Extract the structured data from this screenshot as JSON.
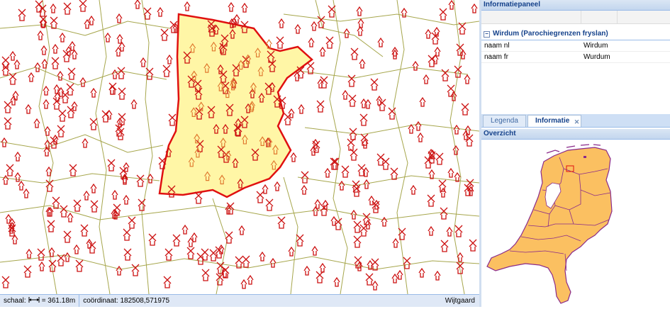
{
  "map": {
    "background": "#ffffff",
    "region_fill": "#fff6a6",
    "region_border": "#e01010",
    "boundary_color": "#a6a64c",
    "marker_color": "#cc1111"
  },
  "statusbar": {
    "scale_label": "schaal:",
    "scale_icon": "scale-bar-icon",
    "scale_value": "= 361.18m",
    "coord_label": "coördinaat: 182508,571975",
    "right_text": "Wijtgaard"
  },
  "info_panel": {
    "title": "Informatiepaneel",
    "group_title": "Wirdum (Parochiegrenzen fryslan)",
    "rows": [
      {
        "key": "naam nl",
        "value": "Wirdum"
      },
      {
        "key": "naam fr",
        "value": "Wurdum"
      }
    ]
  },
  "tabs": [
    {
      "label": "Legenda",
      "active": false
    },
    {
      "label": "Informatie",
      "active": true
    }
  ],
  "overview": {
    "title": "Overzicht",
    "land_fill": "#fbc061",
    "border_color": "#8a2a8a"
  }
}
